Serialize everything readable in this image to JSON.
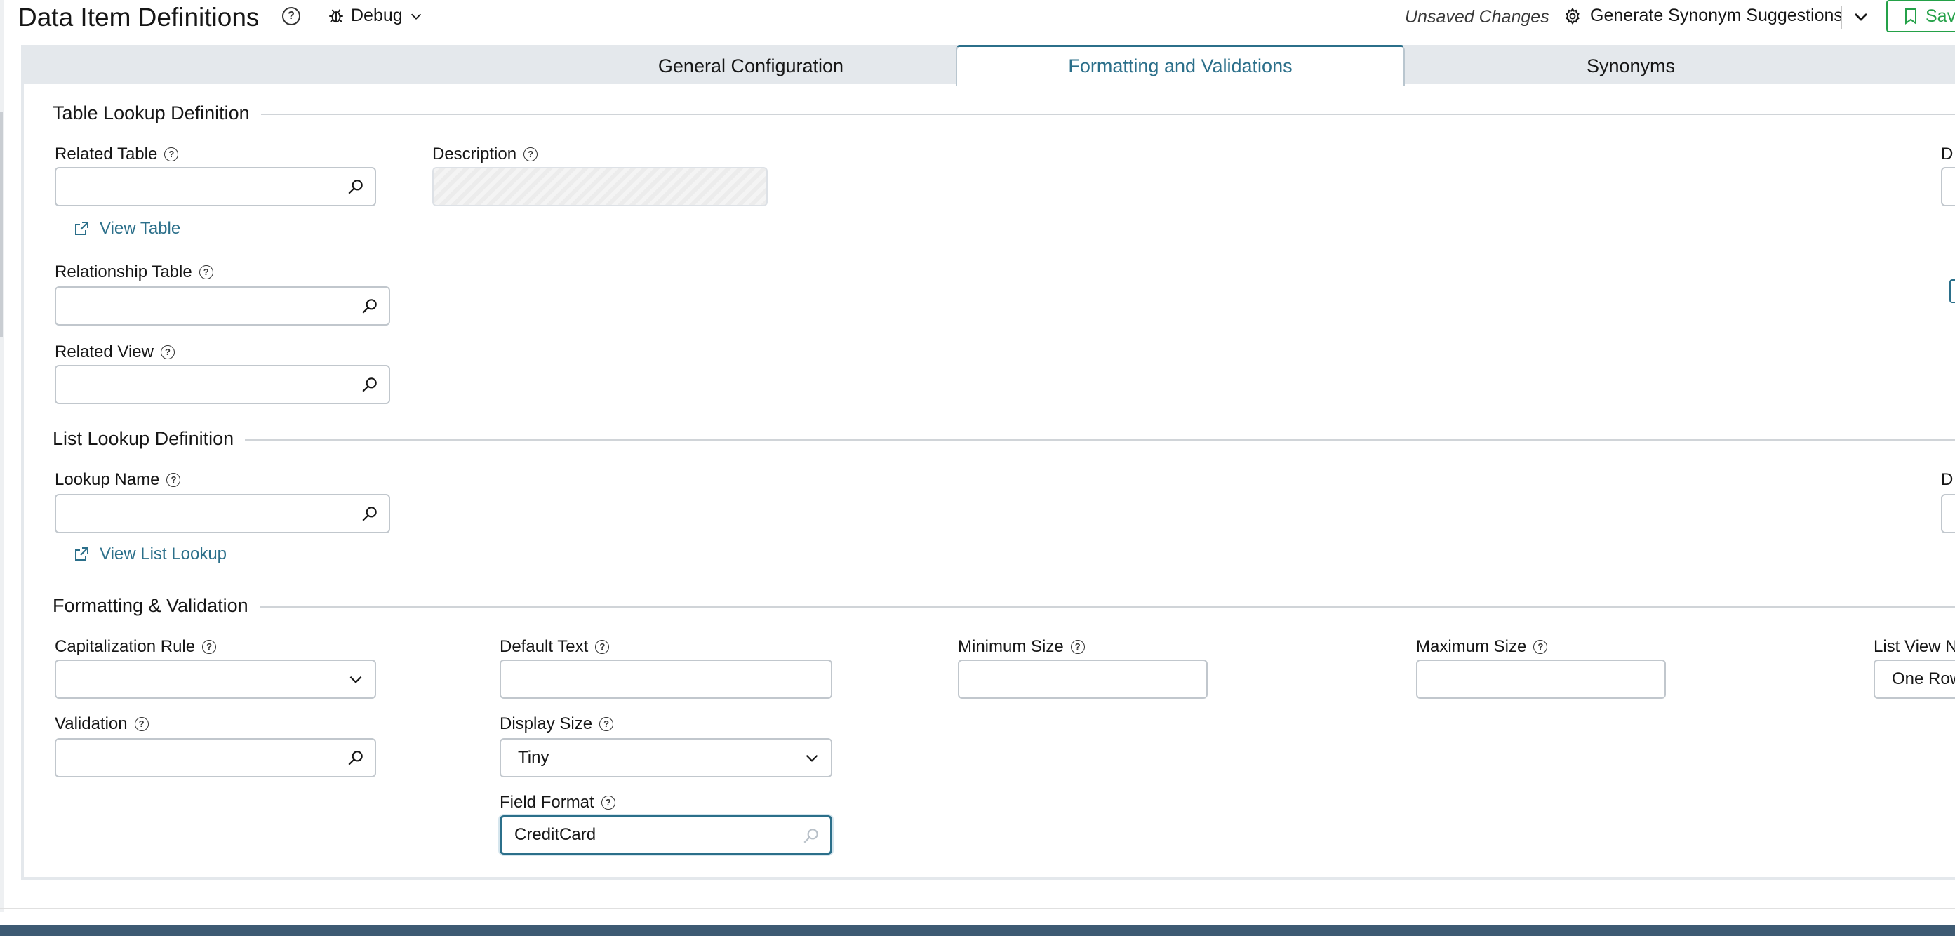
{
  "header": {
    "title": "Data Item Definitions",
    "debug_label": "Debug",
    "unsaved": "Unsaved Changes",
    "synonym_button": "Generate Synonym Suggestions",
    "save_label": "Sav"
  },
  "tabs": [
    {
      "label": "General Configuration",
      "active": false
    },
    {
      "label": "Formatting and Validations",
      "active": true
    },
    {
      "label": "Synonyms",
      "active": false
    }
  ],
  "table_lookup": {
    "section": "Table Lookup Definition",
    "related_table_label": "Related Table",
    "description_label": "Description",
    "view_table_link": "View Table",
    "relationship_table_label": "Relationship Table",
    "related_view_label": "Related View",
    "right_cutoff_label": "D"
  },
  "list_lookup": {
    "section": "List Lookup Definition",
    "lookup_name_label": "Lookup Name",
    "view_list_lookup_link": "View List Lookup",
    "right_cutoff_label": "D"
  },
  "formatting": {
    "section": "Formatting & Validation",
    "capitalization_rule_label": "Capitalization Rule",
    "capitalization_rule_value": "",
    "validation_label": "Validation",
    "default_text_label": "Default Text",
    "display_size_label": "Display Size",
    "display_size_value": "Tiny",
    "field_format_label": "Field Format",
    "field_format_value": "CreditCard",
    "minimum_size_label": "Minimum Size",
    "maximum_size_label": "Maximum Size",
    "list_view_label": "List View N",
    "list_view_value": "One Row"
  },
  "colors": {
    "accent": "#2b6f8a",
    "save_green": "#24a148",
    "footer": "#3d5a73"
  }
}
